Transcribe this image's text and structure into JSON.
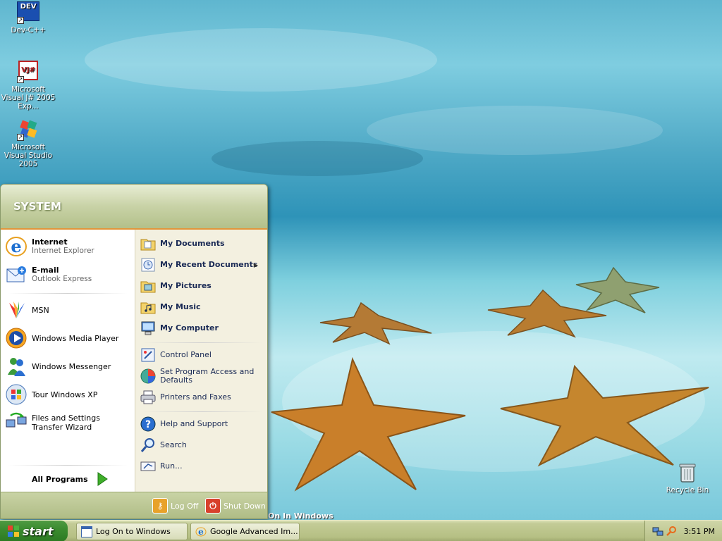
{
  "desktop": {
    "icons": [
      {
        "label": "Dev-C++",
        "badge": "DEV"
      },
      {
        "label": "Microsoft Visual J# 2005 Exp...",
        "badge": "VJ#"
      },
      {
        "label": "Microsoft Visual Studio 2005"
      },
      {
        "label": "Recycle Bin"
      }
    ],
    "partial_window_text": "On In Windows"
  },
  "start_menu": {
    "user": "SYSTEM",
    "pinned": [
      {
        "title": "Internet",
        "subtitle": "Internet Explorer",
        "icon": "internet-explorer-icon"
      },
      {
        "title": "E-mail",
        "subtitle": "Outlook Express",
        "icon": "outlook-express-icon"
      }
    ],
    "recent": [
      {
        "label": "MSN",
        "icon": "msn-icon"
      },
      {
        "label": "Windows Media Player",
        "icon": "media-player-icon"
      },
      {
        "label": "Windows Messenger",
        "icon": "messenger-icon"
      },
      {
        "label": "Tour Windows XP",
        "icon": "tour-icon"
      },
      {
        "label": "Files and Settings Transfer Wizard",
        "icon": "transfer-wizard-icon"
      }
    ],
    "all_programs": "All Programs",
    "right_bold": [
      {
        "label": "My Documents",
        "icon": "folder-documents-icon"
      },
      {
        "label": "My Recent Documents",
        "icon": "recent-documents-icon"
      },
      {
        "label": "My Pictures",
        "icon": "folder-pictures-icon"
      },
      {
        "label": "My Music",
        "icon": "folder-music-icon"
      },
      {
        "label": "My Computer",
        "icon": "my-computer-icon"
      }
    ],
    "right_settings": [
      {
        "label": "Control Panel",
        "icon": "control-panel-icon"
      },
      {
        "label": "Set Program Access and Defaults",
        "icon": "program-defaults-icon"
      },
      {
        "label": "Printers and Faxes",
        "icon": "printer-icon"
      }
    ],
    "right_help": [
      {
        "label": "Help and Support",
        "icon": "help-icon"
      },
      {
        "label": "Search",
        "icon": "search-icon"
      },
      {
        "label": "Run...",
        "icon": "run-icon"
      }
    ],
    "footer": {
      "log_off": "Log Off",
      "shut_down": "Shut Down"
    }
  },
  "taskbar": {
    "start_label": "start",
    "tasks": [
      {
        "label": "Log On to Windows"
      },
      {
        "label": "Google Advanced Im..."
      }
    ],
    "clock": "3:51 PM"
  },
  "colors": {
    "start_green": "#3a8a2e",
    "taskbar_olive": "#b6c084",
    "header_accent": "#e2953a"
  }
}
